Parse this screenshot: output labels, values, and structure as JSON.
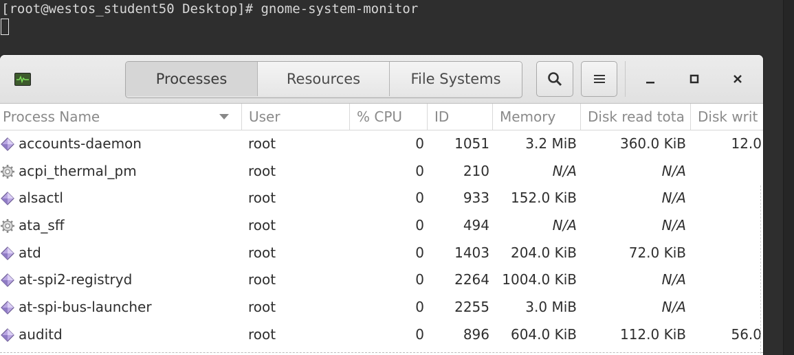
{
  "terminal": {
    "prompt_line": "[root@westos_student50 Desktop]# gnome-system-monitor"
  },
  "window": {
    "tabs": [
      {
        "label": "Processes",
        "active": true
      },
      {
        "label": "Resources",
        "active": false
      },
      {
        "label": "File Systems",
        "active": false
      }
    ],
    "icons": {
      "app": "system-monitor-app-icon",
      "search": "search-icon",
      "menu": "hamburger-menu-icon",
      "minimize": "minimize-icon",
      "maximize": "maximize-icon",
      "close": "close-icon"
    }
  },
  "table": {
    "columns": {
      "name": "Process Name",
      "user": "User",
      "cpu": "% CPU",
      "id": "ID",
      "memory": "Memory",
      "disk_read": "Disk read tota",
      "disk_write": "Disk writ"
    },
    "rows": [
      {
        "icon": "diamond",
        "name": "accounts-daemon",
        "user": "root",
        "cpu": "0",
        "id": "1051",
        "memory": "3.2 MiB",
        "disk_read": "360.0 KiB",
        "disk_write": "12.0"
      },
      {
        "icon": "gear",
        "name": "acpi_thermal_pm",
        "user": "root",
        "cpu": "0",
        "id": "210",
        "memory": "N/A",
        "disk_read": "N/A",
        "disk_write": ""
      },
      {
        "icon": "diamond",
        "name": "alsactl",
        "user": "root",
        "cpu": "0",
        "id": "933",
        "memory": "152.0 KiB",
        "disk_read": "N/A",
        "disk_write": ""
      },
      {
        "icon": "gear",
        "name": "ata_sff",
        "user": "root",
        "cpu": "0",
        "id": "494",
        "memory": "N/A",
        "disk_read": "N/A",
        "disk_write": ""
      },
      {
        "icon": "diamond",
        "name": "atd",
        "user": "root",
        "cpu": "0",
        "id": "1403",
        "memory": "204.0 KiB",
        "disk_read": "72.0 KiB",
        "disk_write": ""
      },
      {
        "icon": "diamond",
        "name": "at-spi2-registryd",
        "user": "root",
        "cpu": "0",
        "id": "2264",
        "memory": "1004.0 KiB",
        "disk_read": "N/A",
        "disk_write": ""
      },
      {
        "icon": "diamond",
        "name": "at-spi-bus-launcher",
        "user": "root",
        "cpu": "0",
        "id": "2255",
        "memory": "3.0 MiB",
        "disk_read": "N/A",
        "disk_write": ""
      },
      {
        "icon": "diamond",
        "name": "auditd",
        "user": "root",
        "cpu": "0",
        "id": "896",
        "memory": "604.0 KiB",
        "disk_read": "112.0 KiB",
        "disk_write": "56.0"
      }
    ]
  }
}
